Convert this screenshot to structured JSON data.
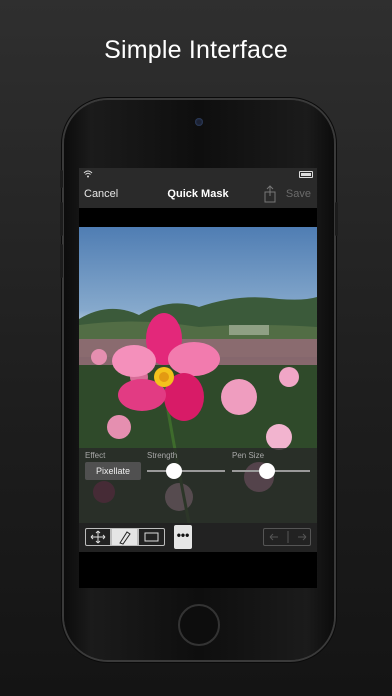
{
  "headline": "Simple Interface",
  "navbar": {
    "cancel_label": "Cancel",
    "title": "Quick Mask",
    "save_label": "Save"
  },
  "controls": {
    "effect_label": "Effect",
    "effect_value": "Pixellate",
    "strength_label": "Strength",
    "strength_value": 0.35,
    "pen_size_label": "Pen Size",
    "pen_size_value": 0.45
  },
  "toolbar": {
    "tools": [
      "move-icon",
      "brush-icon",
      "eraser-icon"
    ],
    "selected_tool": "brush-icon",
    "more_label": "•••"
  },
  "colors": {
    "background": "#1d1d1d",
    "bar": "#2a2a2a",
    "accent": "#ffffff",
    "save_disabled": "#6b6b6b"
  }
}
